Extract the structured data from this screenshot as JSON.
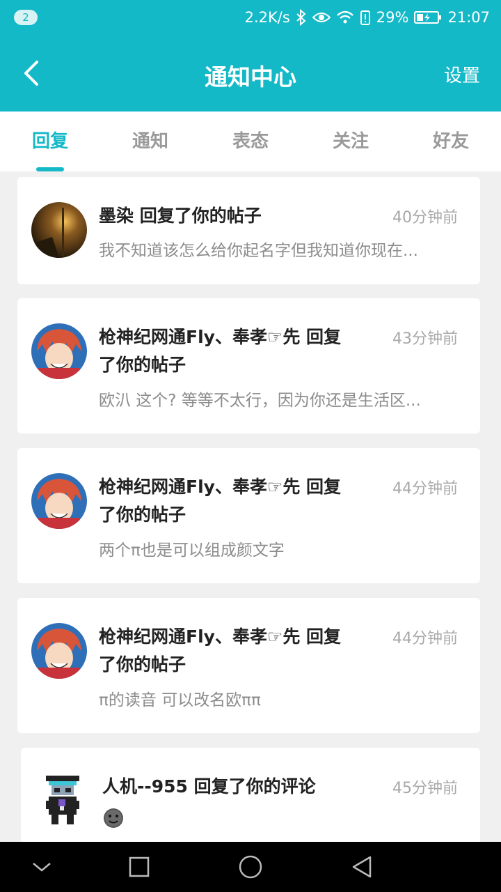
{
  "status_bar": {
    "notification_count": "2",
    "net_speed": "2.2K/s",
    "battery": "29%",
    "time": "21:07"
  },
  "header": {
    "title": "通知中心",
    "settings_label": "设置"
  },
  "tabs": [
    {
      "label": "回复",
      "active": true
    },
    {
      "label": "通知",
      "active": false
    },
    {
      "label": "表态",
      "active": false
    },
    {
      "label": "关注",
      "active": false
    },
    {
      "label": "好友",
      "active": false
    }
  ],
  "notifications": [
    {
      "title": "墨染 回复了你的帖子",
      "time": "40分钟前",
      "snippet": "我不知道该怎么给你起名字但我知道你现在..."
    },
    {
      "title_line1": "枪神纪网通Fly、奉孝☞先 回复",
      "title_line2": "了你的帖子",
      "time": "43分钟前",
      "snippet": "欧汃 这个? 等等不太行，因为你还是生活区..."
    },
    {
      "title_line1": "枪神纪网通Fly、奉孝☞先 回复",
      "title_line2": "了你的帖子",
      "time": "44分钟前",
      "snippet": "两个π也是可以组成颜文字"
    },
    {
      "title_line1": "枪神纪网通Fly、奉孝☞先 回复",
      "title_line2": "了你的帖子",
      "time": "44分钟前",
      "snippet": "π的读音 可以改名欧ππ"
    },
    {
      "title": "人机--955 回复了你的评论",
      "time": "45分钟前"
    }
  ],
  "colors": {
    "brand": "#14b9c8",
    "title_text": "#222222",
    "muted_text": "#a8a8a8"
  }
}
